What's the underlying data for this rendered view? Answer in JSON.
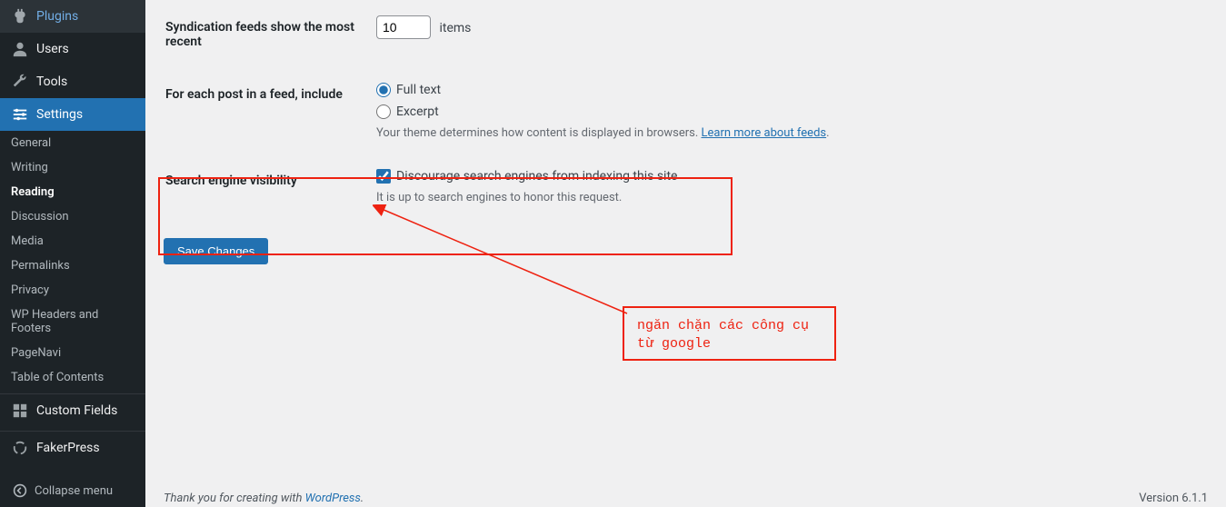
{
  "sidebar": {
    "top_items": [
      {
        "icon": "plug",
        "label": "Plugins"
      },
      {
        "icon": "user",
        "label": "Users"
      },
      {
        "icon": "wrench",
        "label": "Tools"
      },
      {
        "icon": "sliders",
        "label": "Settings",
        "current": true
      }
    ],
    "sub_items": [
      "General",
      "Writing",
      "Reading",
      "Discussion",
      "Media",
      "Permalinks",
      "Privacy",
      "WP Headers and Footers",
      "PageNavi",
      "Table of Contents"
    ],
    "current_sub": "Reading",
    "bottom_items": [
      {
        "icon": "grid",
        "label": "Custom Fields"
      },
      {
        "icon": "spinner",
        "label": "FakerPress"
      }
    ],
    "collapse": "Collapse menu"
  },
  "form": {
    "feeds_label": "Syndication feeds show the most recent",
    "feeds_value": "10",
    "items_text": "items",
    "feed_include_label": "For each post in a feed, include",
    "full_text": "Full text",
    "excerpt": "Excerpt",
    "theme_note": "Your theme determines how content is displayed in browsers. ",
    "learn_link": "Learn more about feeds",
    "search_label": "Search engine visibility",
    "discourage": "Discourage search engines from indexing this site",
    "honor_note": "It is up to search engines to honor this request.",
    "save": "Save Changes"
  },
  "annotation": "ngăn chặn các công cụ từ google",
  "footer": {
    "thank": "Thank you for creating with ",
    "wp": "WordPress",
    "version": "Version 6.1.1"
  }
}
